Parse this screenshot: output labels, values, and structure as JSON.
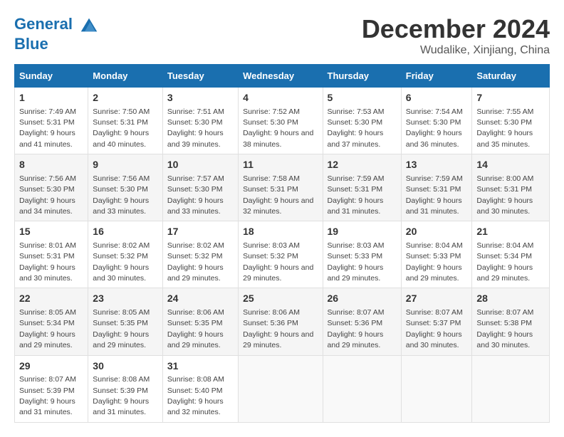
{
  "logo": {
    "line1": "General",
    "line2": "Blue"
  },
  "title": "December 2024",
  "subtitle": "Wudalike, Xinjiang, China",
  "header": {
    "accent_color": "#1a6faf"
  },
  "weekdays": [
    "Sunday",
    "Monday",
    "Tuesday",
    "Wednesday",
    "Thursday",
    "Friday",
    "Saturday"
  ],
  "weeks": [
    [
      {
        "day": "1",
        "sunrise": "7:49 AM",
        "sunset": "5:31 PM",
        "daylight": "9 hours and 41 minutes."
      },
      {
        "day": "2",
        "sunrise": "7:50 AM",
        "sunset": "5:31 PM",
        "daylight": "9 hours and 40 minutes."
      },
      {
        "day": "3",
        "sunrise": "7:51 AM",
        "sunset": "5:30 PM",
        "daylight": "9 hours and 39 minutes."
      },
      {
        "day": "4",
        "sunrise": "7:52 AM",
        "sunset": "5:30 PM",
        "daylight": "9 hours and 38 minutes."
      },
      {
        "day": "5",
        "sunrise": "7:53 AM",
        "sunset": "5:30 PM",
        "daylight": "9 hours and 37 minutes."
      },
      {
        "day": "6",
        "sunrise": "7:54 AM",
        "sunset": "5:30 PM",
        "daylight": "9 hours and 36 minutes."
      },
      {
        "day": "7",
        "sunrise": "7:55 AM",
        "sunset": "5:30 PM",
        "daylight": "9 hours and 35 minutes."
      }
    ],
    [
      {
        "day": "8",
        "sunrise": "7:56 AM",
        "sunset": "5:30 PM",
        "daylight": "9 hours and 34 minutes."
      },
      {
        "day": "9",
        "sunrise": "7:56 AM",
        "sunset": "5:30 PM",
        "daylight": "9 hours and 33 minutes."
      },
      {
        "day": "10",
        "sunrise": "7:57 AM",
        "sunset": "5:30 PM",
        "daylight": "9 hours and 33 minutes."
      },
      {
        "day": "11",
        "sunrise": "7:58 AM",
        "sunset": "5:31 PM",
        "daylight": "9 hours and 32 minutes."
      },
      {
        "day": "12",
        "sunrise": "7:59 AM",
        "sunset": "5:31 PM",
        "daylight": "9 hours and 31 minutes."
      },
      {
        "day": "13",
        "sunrise": "7:59 AM",
        "sunset": "5:31 PM",
        "daylight": "9 hours and 31 minutes."
      },
      {
        "day": "14",
        "sunrise": "8:00 AM",
        "sunset": "5:31 PM",
        "daylight": "9 hours and 30 minutes."
      }
    ],
    [
      {
        "day": "15",
        "sunrise": "8:01 AM",
        "sunset": "5:31 PM",
        "daylight": "9 hours and 30 minutes."
      },
      {
        "day": "16",
        "sunrise": "8:02 AM",
        "sunset": "5:32 PM",
        "daylight": "9 hours and 30 minutes."
      },
      {
        "day": "17",
        "sunrise": "8:02 AM",
        "sunset": "5:32 PM",
        "daylight": "9 hours and 29 minutes."
      },
      {
        "day": "18",
        "sunrise": "8:03 AM",
        "sunset": "5:32 PM",
        "daylight": "9 hours and 29 minutes."
      },
      {
        "day": "19",
        "sunrise": "8:03 AM",
        "sunset": "5:33 PM",
        "daylight": "9 hours and 29 minutes."
      },
      {
        "day": "20",
        "sunrise": "8:04 AM",
        "sunset": "5:33 PM",
        "daylight": "9 hours and 29 minutes."
      },
      {
        "day": "21",
        "sunrise": "8:04 AM",
        "sunset": "5:34 PM",
        "daylight": "9 hours and 29 minutes."
      }
    ],
    [
      {
        "day": "22",
        "sunrise": "8:05 AM",
        "sunset": "5:34 PM",
        "daylight": "9 hours and 29 minutes."
      },
      {
        "day": "23",
        "sunrise": "8:05 AM",
        "sunset": "5:35 PM",
        "daylight": "9 hours and 29 minutes."
      },
      {
        "day": "24",
        "sunrise": "8:06 AM",
        "sunset": "5:35 PM",
        "daylight": "9 hours and 29 minutes."
      },
      {
        "day": "25",
        "sunrise": "8:06 AM",
        "sunset": "5:36 PM",
        "daylight": "9 hours and 29 minutes."
      },
      {
        "day": "26",
        "sunrise": "8:07 AM",
        "sunset": "5:36 PM",
        "daylight": "9 hours and 29 minutes."
      },
      {
        "day": "27",
        "sunrise": "8:07 AM",
        "sunset": "5:37 PM",
        "daylight": "9 hours and 30 minutes."
      },
      {
        "day": "28",
        "sunrise": "8:07 AM",
        "sunset": "5:38 PM",
        "daylight": "9 hours and 30 minutes."
      }
    ],
    [
      {
        "day": "29",
        "sunrise": "8:07 AM",
        "sunset": "5:39 PM",
        "daylight": "9 hours and 31 minutes."
      },
      {
        "day": "30",
        "sunrise": "8:08 AM",
        "sunset": "5:39 PM",
        "daylight": "9 hours and 31 minutes."
      },
      {
        "day": "31",
        "sunrise": "8:08 AM",
        "sunset": "5:40 PM",
        "daylight": "9 hours and 32 minutes."
      },
      null,
      null,
      null,
      null
    ]
  ]
}
